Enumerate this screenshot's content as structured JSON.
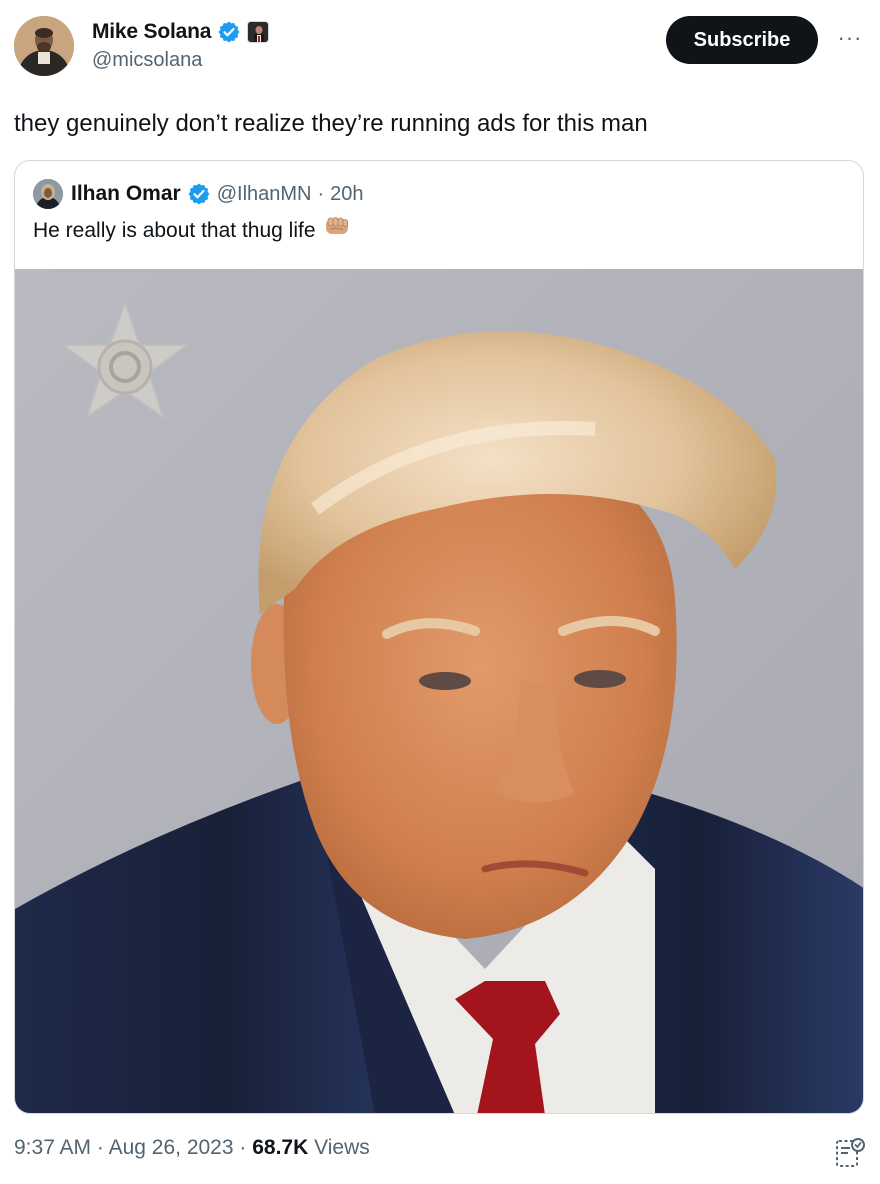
{
  "author": {
    "name": "Mike Solana",
    "handle": "@micsolana",
    "avatar": "author-avatar",
    "verified_icon": "verified-badge-icon",
    "affiliation_icon": "affiliation-badge-icon"
  },
  "actions": {
    "subscribe_label": "Subscribe",
    "more_icon": "more-options-icon",
    "more_glyph": "···"
  },
  "tweet": {
    "text": "they genuinely don’t realize they’re running ads for this man"
  },
  "quoted": {
    "name": "Ilhan Omar",
    "handle": "@IlhanMN",
    "separator": "·",
    "time": "20h",
    "text": "He really is about that thug life",
    "emoji_icon": "fist-bump-emoji-icon",
    "media": "mugshot-photo"
  },
  "footer": {
    "time": "9:37 AM",
    "sep1": "·",
    "date": "Aug 26, 2023",
    "sep2": "·",
    "views_count": "68.7K",
    "views_label": "Views",
    "analytics_icon": "analytics-icon"
  },
  "colors": {
    "text_primary": "#0f1419",
    "text_secondary": "#536471",
    "verified_blue": "#1d9bf0",
    "border": "#cfd9de",
    "button_dark": "#0f1419"
  }
}
